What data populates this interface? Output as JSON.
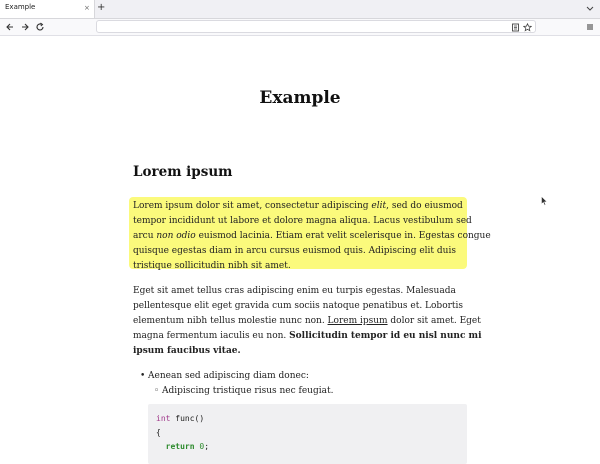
{
  "browser": {
    "tab_title": "Example",
    "tab_close": "×",
    "new_tab": "+",
    "url": "",
    "icons": [
      "back-arrow-icon",
      "forward-arrow-icon",
      "reload-icon",
      "reader-view-icon",
      "bookmark-star-icon",
      "hamburger-menu-icon",
      "tab-list-chevron-icon"
    ]
  },
  "page": {
    "title": "Example",
    "heading": "Lorem ipsum",
    "para1": {
      "l1a": "Lorem ipsum dolor sit amet, consectetur adipiscing ",
      "l1b": "elit",
      "l1c": ", sed do eiusmod",
      "l2": "tempor incididunt ut labore et dolore magna aliqua. Lacus vestibulum sed",
      "l3a": "arcu ",
      "l3b": "non odio",
      "l3c": " euismod lacinia. Etiam erat velit scelerisque in. Egestas congue",
      "l4": "quisque egestas diam in arcu cursus euismod quis. Adipiscing elit duis",
      "l5": "tristique sollicitudin nibh sit amet.",
      "highlight_color": "#fbfa7c"
    },
    "para2": {
      "l1": "Eget sit amet tellus cras adipiscing enim eu turpis egestas. Malesuada",
      "l2": "pellentesque elit eget gravida cum sociis natoque penatibus et. Lobortis",
      "l3a": "elementum nibh tellus molestie nunc non. ",
      "l3b": "Lorem ipsum",
      "l3c": " dolor sit amet. Eget",
      "l4a": "magna fermentum iaculis eu non. ",
      "l4b": "Sollicitudin tempor id eu nisl nunc mi",
      "l5": "ipsum faucibus vitae."
    },
    "list": {
      "item1": "Aenean sed adipiscing diam donec:",
      "subitem1": "Adipiscing tristique risus nec feugiat."
    },
    "code": {
      "l1a": "int",
      "l1b": " func()",
      "l2": "{",
      "l3a": "  ",
      "l3b": "return",
      "l3c": " ",
      "l3d": "0",
      "l3e": ";"
    }
  }
}
